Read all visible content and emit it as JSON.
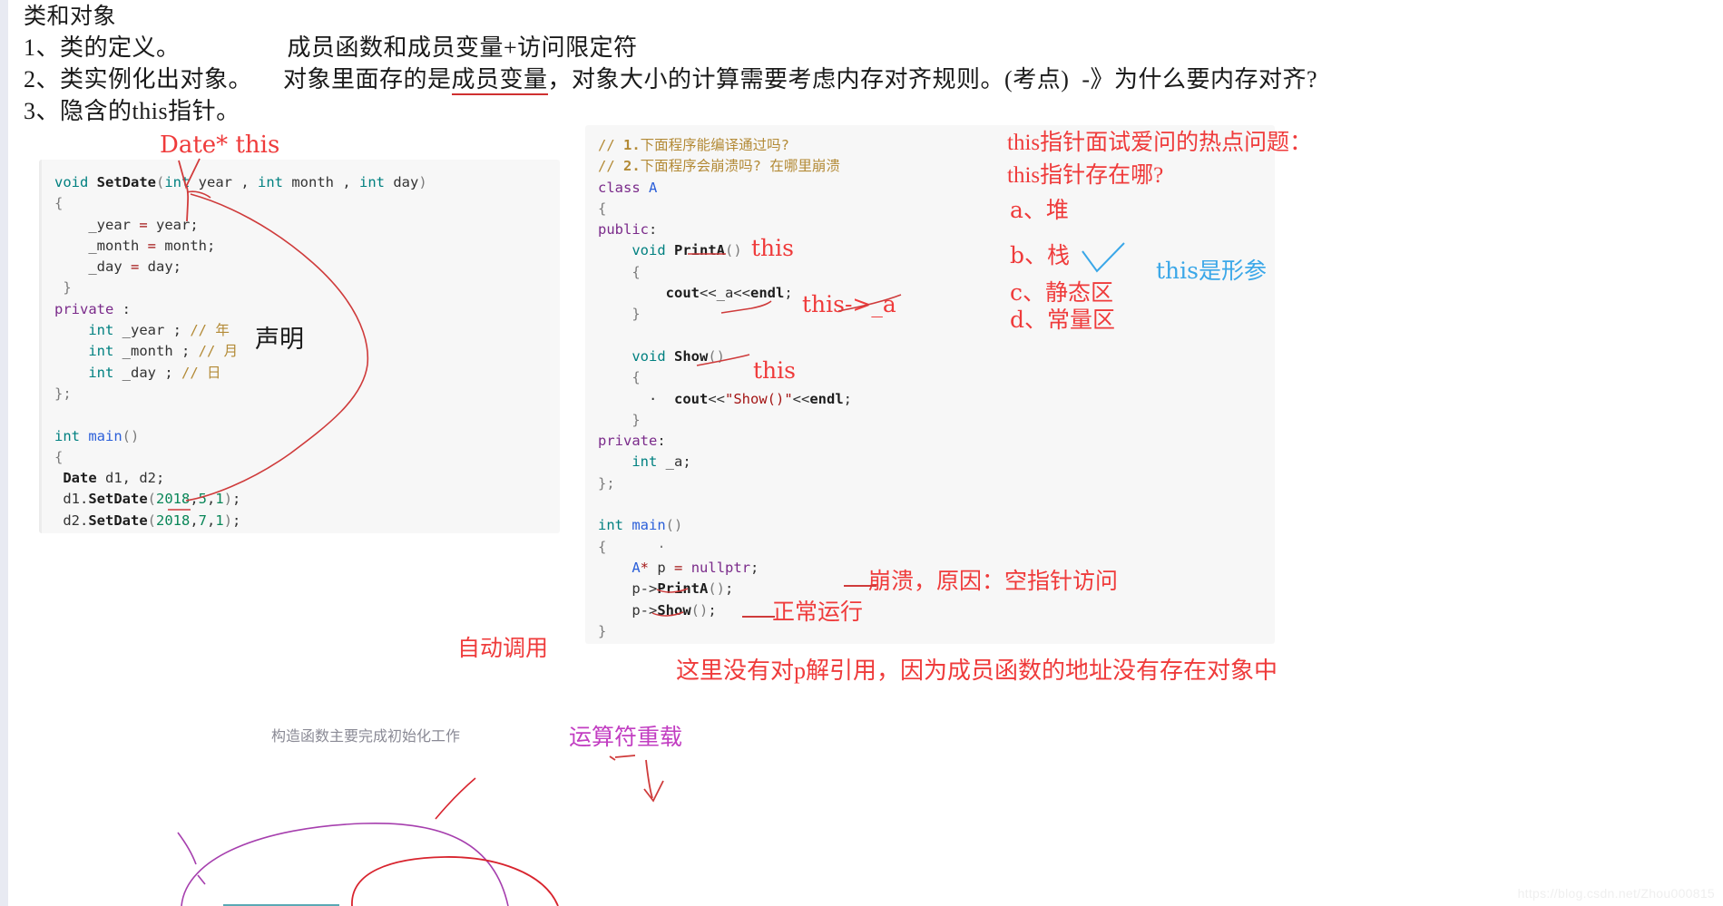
{
  "page": {
    "watermark": "https://blog.csdn.net/Zhou000815"
  },
  "heading": {
    "title": "类和对象",
    "items": [
      {
        "num": "1、类的定义。",
        "detail": "成员函数和成员变量+访问限定符"
      },
      {
        "num": "2、类实例化出对象。",
        "detail_a": "对象里面存的是",
        "detail_underlined": "成员变量",
        "detail_b": "，对象大小的计算需要考虑内存对齐规则。(考点)  -》为什么要内存对齐?"
      },
      {
        "num": "3、隐含的this指针。",
        "detail": ""
      }
    ]
  },
  "left_code": {
    "lines": [
      "void SetDate(int year , int month , int day)",
      "{",
      "    _year = year;",
      "    _month = month;",
      "    _day = day;",
      "}",
      "private :",
      "    int _year ; // 年",
      "    int _month ; // 月",
      "    int _day ; // 日",
      "};",
      "",
      "int main()",
      "{",
      " Date d1, d2;",
      " d1.SetDate(2018,5,1);",
      " d2.SetDate(2018,7,1);"
    ]
  },
  "right_code": {
    "lines": [
      "// 1.下面程序能编译通过吗?",
      "// 2.下面程序会崩溃吗? 在哪里崩溃",
      "class A",
      "{",
      "public:",
      "    void PrintA()",
      "    {",
      "        cout<<_a<<endl;",
      "    }",
      "",
      "    void Show()",
      "    {",
      "      ·  cout<<\"Show()\"<<endl;",
      "    }",
      "private:",
      "    int _a;",
      "};",
      "",
      "int main()",
      "{      ·",
      "    A* p = nullptr;",
      "    p->PrintA();",
      "    p->Show();",
      "}"
    ]
  },
  "annotations": {
    "date_this": "Date* this",
    "declaration": "声明",
    "this_printa": "this",
    "this_arrow_a": "this->_a",
    "this_show": "this",
    "crash_note": "崩溃，原因：空指针访问",
    "normal_run": "正常运行",
    "auto_call": "自动调用",
    "deref_note": "这里没有对p解引用，因为成员函数的地址没有存在对象中",
    "operator_overload": "运算符重载",
    "constructor_note": "构造函数主要完成初始化工作",
    "this_is_param": "this是形参",
    "quiz": {
      "q1": "this指针面试爱问的热点问题：",
      "q2": "this指针存在哪?",
      "options": [
        "a、堆",
        "b、栈",
        "c、静态区",
        "d、常量区"
      ]
    }
  },
  "colors": {
    "red_ink": "#ef3b3b",
    "blue_ink": "#3aa7e8",
    "purple_ink": "#c23ec2",
    "panel_bg": "#f7f7f7",
    "page_rule": "#e8eaf2"
  }
}
